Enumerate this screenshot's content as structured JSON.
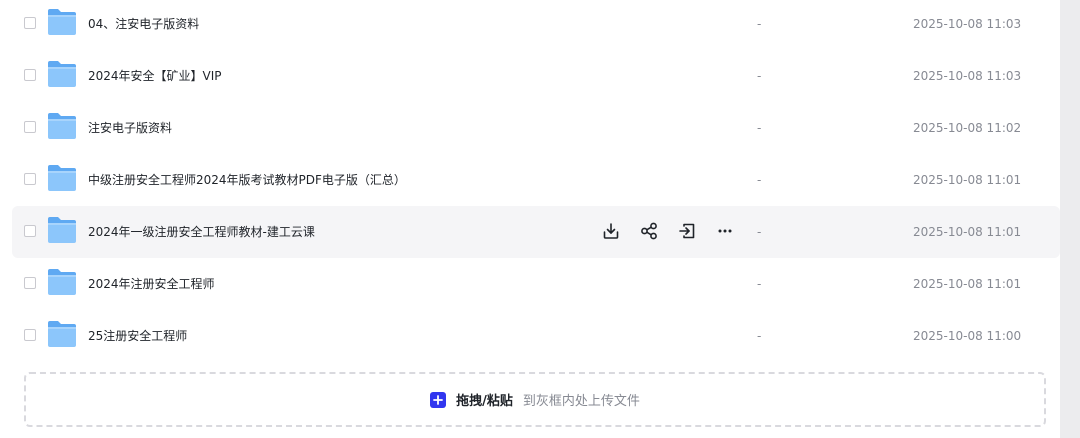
{
  "files": [
    {
      "name": "04、注安电子版资料",
      "size": "-",
      "date": "2025-10-08 11:03",
      "icon": "folder-icon"
    },
    {
      "name": "2024年安全【矿业】VIP",
      "size": "-",
      "date": "2025-10-08 11:03",
      "icon": "folder-icon"
    },
    {
      "name": "注安电子版资料",
      "size": "-",
      "date": "2025-10-08 11:02",
      "icon": "folder-icon"
    },
    {
      "name": "中级注册安全工程师2024年版考试教材PDF电子版（汇总）",
      "size": "-",
      "date": "2025-10-08 11:01",
      "icon": "folder-icon"
    },
    {
      "name": "2024年一级注册安全工程师教材-建工云课",
      "size": "-",
      "date": "2025-10-08 11:01",
      "icon": "folder-icon"
    },
    {
      "name": "2024年注册安全工程师",
      "size": "-",
      "date": "2025-10-08 11:01",
      "icon": "folder-icon"
    },
    {
      "name": "25注册安全工程师",
      "size": "-",
      "date": "2025-10-08 11:00",
      "icon": "folder-icon"
    }
  ],
  "hover_actions": {
    "download": "download-icon",
    "share": "share-icon",
    "move": "move-icon",
    "more": "more-icon"
  },
  "upload": {
    "primary": "拖拽/粘贴",
    "secondary": "到灰框内处上传文件",
    "icon": "plus-icon"
  },
  "colors": {
    "accent": "#3136ef",
    "folder": "#62aef6",
    "hover_row": "#f5f5f7"
  }
}
